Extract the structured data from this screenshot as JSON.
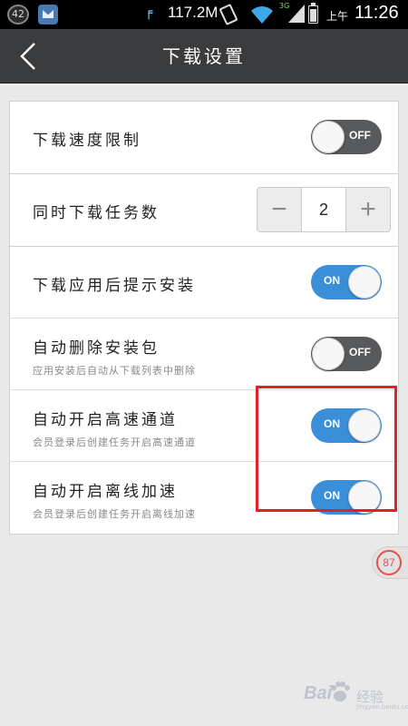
{
  "status_bar": {
    "notification_count": "42",
    "network_speed": "117.2M",
    "network_type": "3G",
    "ampm": "上午",
    "time": "11:26"
  },
  "header": {
    "title": "下载设置",
    "back_icon": "chevron-left-icon"
  },
  "settings": {
    "speed_limit": {
      "label": "下载速度限制",
      "toggle_text": "OFF",
      "state": "off"
    },
    "concurrent": {
      "label": "同时下载任务数",
      "value": "2",
      "minus": "−",
      "plus": "+"
    },
    "prompt_install": {
      "label": "下载应用后提示安装",
      "toggle_text": "ON",
      "state": "on"
    },
    "auto_delete": {
      "label": "自动删除安装包",
      "sub": "应用安装后自动从下载列表中删除",
      "toggle_text": "OFF",
      "state": "off"
    },
    "high_speed": {
      "label": "自动开启高速通道",
      "sub": "会员登录后创建任务开启高速通道",
      "toggle_text": "ON",
      "state": "on"
    },
    "offline_accel": {
      "label": "自动开启离线加速",
      "sub": "会员登录后创建任务开启离线加速",
      "toggle_text": "ON",
      "state": "on"
    }
  },
  "float_badge": {
    "value": "87"
  },
  "watermark": {
    "brand": "Bai",
    "brand_tail": "经验",
    "url": "jingyan.baidu.com"
  },
  "colors": {
    "toggle_on": "#3b8fd8",
    "toggle_off": "#58595b",
    "highlight": "#e0202a",
    "title_bar": "#3a3b3c"
  }
}
